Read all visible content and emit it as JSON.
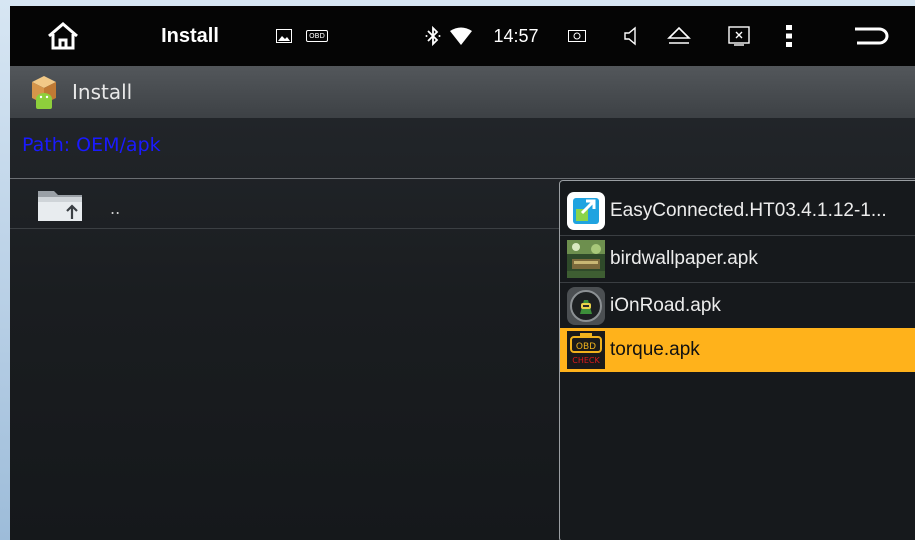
{
  "status_bar": {
    "title": "Install",
    "time": "14:57",
    "obd_label": "OBD",
    "icons": [
      "home-icon",
      "gallery-icon",
      "obd-icon",
      "bluetooth-icon",
      "wifi-icon",
      "screenshot-icon",
      "volume-icon",
      "eject-icon",
      "close-app-icon",
      "overflow-menu-icon",
      "back-icon"
    ]
  },
  "action_bar": {
    "title": "Install",
    "icon": "package-android-icon"
  },
  "path": {
    "text": "Path:  OEM/apk"
  },
  "parent": {
    "label": "..",
    "icon": "folder-up-icon"
  },
  "apk_list": {
    "items": [
      {
        "name": "EasyConnected.HT03.4.1.12-1...",
        "icon": "easyconnected-icon",
        "selected": false
      },
      {
        "name": "birdwallpaper.apk",
        "icon": "bird-wallpaper-icon",
        "selected": false
      },
      {
        "name": "iOnRoad.apk",
        "icon": "ionroad-icon",
        "selected": false
      },
      {
        "name": "torque.apk",
        "icon": "torque-obd-icon",
        "selected": true
      }
    ],
    "highlight_color": "#ffb21b"
  },
  "colors": {
    "path_text": "#1a1aff",
    "status_bar": "#050505"
  }
}
